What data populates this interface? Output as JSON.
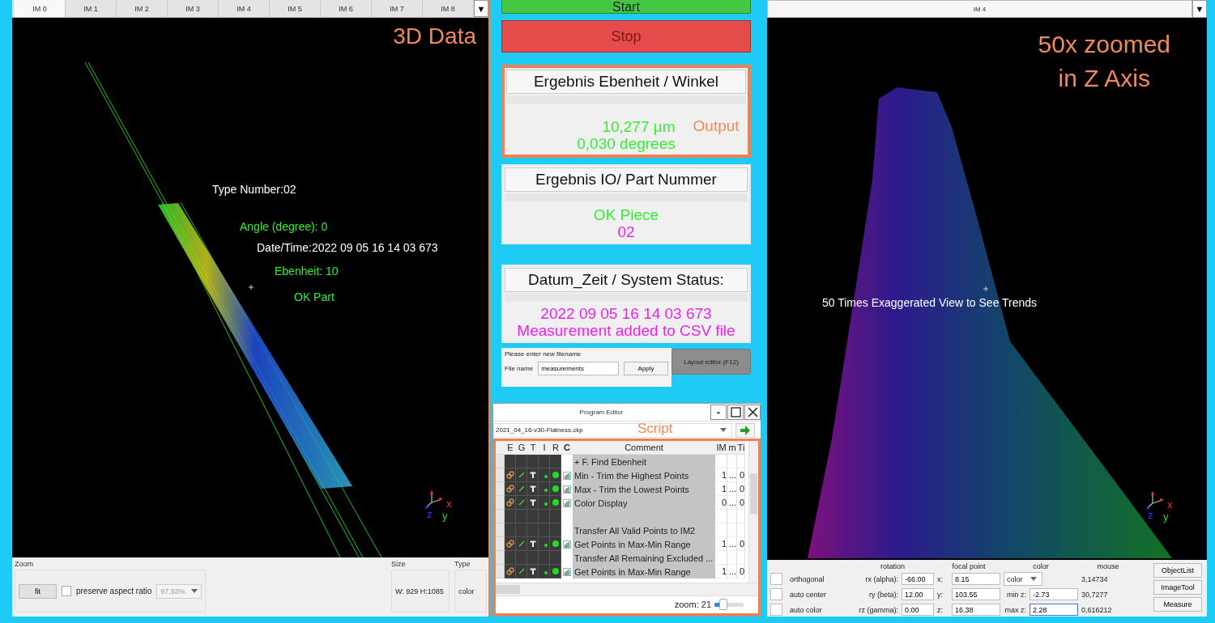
{
  "image_view": {
    "tabs": [
      {
        "label": "IM 0",
        "selected": true
      },
      {
        "label": "IM 1",
        "selected": false
      },
      {
        "label": "IM 2",
        "selected": false
      },
      {
        "label": "IM 3",
        "selected": false
      },
      {
        "label": "IM 4",
        "selected": false
      },
      {
        "label": "IM 5",
        "selected": false
      },
      {
        "label": "IM 6",
        "selected": false
      },
      {
        "label": "IM 7",
        "selected": false
      },
      {
        "label": "IM 8",
        "selected": false
      }
    ],
    "menu_button": "▼",
    "overlay_title": "3D Data",
    "annotations": [
      {
        "text": "Type Number:02",
        "color": "#ffffff"
      },
      {
        "text": "Angle (degree): 0",
        "color": "#33ee33"
      },
      {
        "text": "Date/Time:2022 09 05 16 14 03 673",
        "color": "#ffffff"
      },
      {
        "text": "Ebenheit: 10",
        "color": "#33ee33"
      },
      {
        "text": "OK Part",
        "color": "#33ee33"
      }
    ],
    "axis_labels": {
      "x": "x",
      "y": "y",
      "z": "z"
    },
    "zoom_panel": {
      "title": "Zoom",
      "fit_button": "fit",
      "preserve_aspect_ratio": {
        "label": "preserve aspect ratio",
        "checked": false
      },
      "zoom_value": "97,93%"
    },
    "size": {
      "title": "Size",
      "value": "W: 929  H:1085"
    },
    "type": {
      "title": "Type",
      "value": "color"
    }
  },
  "controls": {
    "start_button": "Start",
    "stop_button": {
      "label": "Stop",
      "disabled": true
    },
    "results": [
      {
        "title": "Ergebnis Ebenheit / Winkel",
        "highlighted": true,
        "callout": "Output",
        "lines": [
          {
            "text": "10,277 µm",
            "color": "#33ee33"
          },
          {
            "text": "0,030 degrees",
            "color": "#33ee33"
          }
        ]
      },
      {
        "title": "Ergebnis IO/ Part Nummer",
        "highlighted": false,
        "lines": [
          {
            "text": "OK Piece",
            "color": "#33ee33"
          },
          {
            "text": "02",
            "color": "#ee22ee"
          }
        ]
      },
      {
        "title": "Datum_Zeit / System Status:",
        "highlighted": false,
        "lines": [
          {
            "text": "2022 09 05 16 14 03 673",
            "color": "#ee22ee"
          },
          {
            "text": "Measurement added to CSV file",
            "color": "#ee22ee"
          }
        ]
      }
    ],
    "filename_panel": {
      "prompt": "Please enter new filename",
      "label": "File name",
      "value": "measurements",
      "apply_button": "Apply"
    },
    "layout_editor_button": "Layout editor (F12)"
  },
  "program_editor": {
    "title": "Program Editor",
    "minimize_button": "-",
    "file": "2021_04_16-v30-Flatness.ckp",
    "callout": "Script",
    "columns": [
      "E",
      "G",
      "T",
      "I",
      "R",
      "C",
      "Comment",
      "IM",
      "m",
      "Ti"
    ],
    "rows": [
      {
        "kind": "group",
        "comment": "+ F.  Find Ebenheit"
      },
      {
        "kind": "step",
        "comment": "Min - Trim the Highest Points",
        "im": "1",
        "m": "...",
        "ti": "0"
      },
      {
        "kind": "step",
        "comment": "Max - Trim the Lowest Points",
        "im": "1",
        "m": "...",
        "ti": "0"
      },
      {
        "kind": "step",
        "comment": "Color Display",
        "im": "0",
        "m": "...",
        "ti": "0"
      },
      {
        "kind": "note"
      },
      {
        "kind": "note",
        "comment": "Transfer All Valid Points to IM2"
      },
      {
        "kind": "step",
        "comment": "Get Points in Max-Min Range",
        "im": "1",
        "m": "...",
        "ti": "0"
      },
      {
        "kind": "note",
        "comment": "Transfer All Remaining Excluded ..."
      },
      {
        "kind": "step",
        "comment": "Get Points in Max-Min Range",
        "im": "1",
        "m": "...",
        "ti": "0"
      }
    ],
    "zoom_label": "zoom: 21",
    "zoom_level": {
      "level": 0.3
    }
  },
  "viewer_3d": {
    "title": "IM 4",
    "menu_button": "▼",
    "overlay_title": [
      "50x zoomed",
      "in Z Axis"
    ],
    "annotation": "50 Times Exaggerated View to See Trends",
    "axis_labels": {
      "x": "x",
      "y": "y",
      "z": "z"
    },
    "headers": [
      "rotation",
      "focal point",
      "color",
      "mouse"
    ],
    "rows": [
      {
        "checkbox": {
          "label": "orthogonal",
          "checked": false
        },
        "rotation_label": "rx (alpha):",
        "rotation_value": "-66.00",
        "focal_label": "x:",
        "focal_value": "8.15",
        "color": {
          "kind": "dropdown",
          "value": "color"
        },
        "mouse": "3,14734"
      },
      {
        "checkbox": {
          "label": "auto center",
          "checked": false
        },
        "rotation_label": "ry (beta):",
        "rotation_value": "12.00",
        "focal_label": "y:",
        "focal_value": "103.55",
        "color": {
          "kind": "field",
          "label": "min z:",
          "value": "-2.73"
        },
        "mouse": "30,7277"
      },
      {
        "checkbox": {
          "label": "auto color",
          "checked": false
        },
        "rotation_label": "rz (gamma):",
        "rotation_value": "0.00",
        "focal_label": "z:",
        "focal_value": "16.38",
        "color": {
          "kind": "field",
          "label": "max z:",
          "value": "2.28",
          "focused": true
        },
        "mouse": "0,616212"
      }
    ],
    "buttons": [
      "ObjectList",
      "ImageTool",
      "Measure"
    ]
  }
}
